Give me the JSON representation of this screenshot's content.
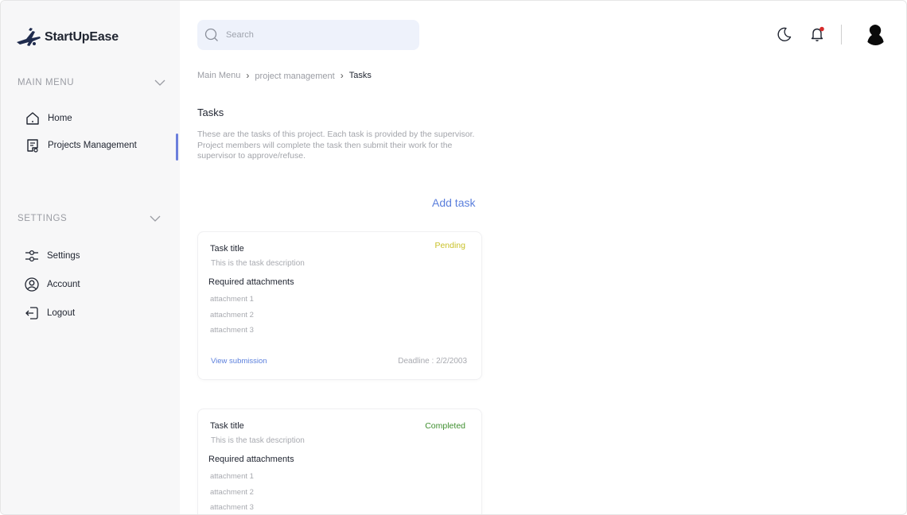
{
  "app": {
    "name": "StartUpEase"
  },
  "sidebar": {
    "main_menu": {
      "label": "MAIN MENU",
      "items": [
        {
          "label": "Home",
          "icon": "home-icon"
        },
        {
          "label": "Projects Management",
          "icon": "document-icon",
          "active": true
        }
      ]
    },
    "settings": {
      "label": "SETTINGS",
      "items": [
        {
          "label": "Settings",
          "icon": "sliders-icon"
        },
        {
          "label": "Account",
          "icon": "user-circle-icon"
        },
        {
          "label": "Logout",
          "icon": "logout-icon"
        }
      ]
    }
  },
  "header": {
    "search": {
      "placeholder": "Search",
      "value": ""
    },
    "icons": [
      "moon-icon",
      "bell-icon",
      "avatar"
    ]
  },
  "breadcrumb": [
    "Main Menu",
    "project management",
    "Tasks"
  ],
  "page": {
    "title": "Tasks",
    "description": "These are the tasks of this project. Each task is provided by the supervisor. Project members will complete the task then submit their work for the supervisor to approve/refuse.",
    "add_task_label": "Add task"
  },
  "tasks": [
    {
      "title": "Task title",
      "status": "Pending",
      "status_color": "#c9c12a",
      "description": "This is the task description",
      "required_label": "Required attachments",
      "attachments": [
        "attachment 1",
        "attachment 2",
        "attachment 3"
      ],
      "view_label": "View submission",
      "deadline": "Deadline : 2/2/2003"
    },
    {
      "title": "Task title",
      "status": "Completed",
      "status_color": "#3f8f2f",
      "description": "This is the task description",
      "required_label": "Required attachments",
      "attachments": [
        "attachment 1",
        "attachment 2",
        "attachment 3"
      ]
    }
  ],
  "colors": {
    "accent": "#5b7fdc",
    "sidebar_bg": "#f7f7f8",
    "search_bg": "#eef2fb",
    "notification_dot": "#d62b2b"
  }
}
